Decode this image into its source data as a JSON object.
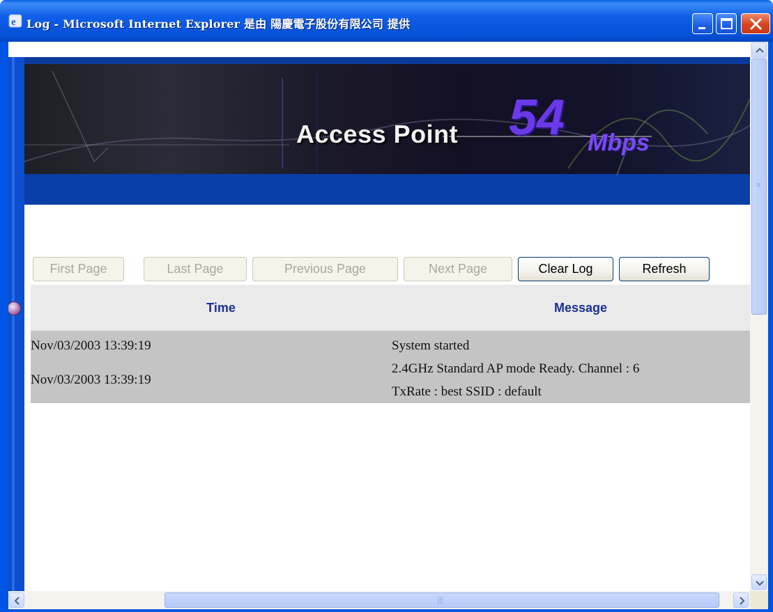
{
  "window": {
    "title": "Log - Microsoft Internet Explorer 是由 陽慶電子股份有限公司 提供"
  },
  "banner": {
    "product_text": "Access Point",
    "speed": "54",
    "speed_unit": "Mbps"
  },
  "buttons": {
    "first_page": "First Page",
    "last_page": "Last Page",
    "previous_page": "Previous Page",
    "next_page": "Next Page",
    "clear_log": "Clear Log",
    "refresh": "Refresh"
  },
  "log": {
    "columns": [
      "Time",
      "Message"
    ],
    "rows": [
      {
        "time": "Nov/03/2003 13:39:19",
        "message": [
          "System started"
        ]
      },
      {
        "time": "Nov/03/2003 13:39:19",
        "message": [
          "2.4GHz Standard AP mode Ready. Channel : 6",
          "TxRate : best SSID : default"
        ]
      }
    ]
  },
  "colors": {
    "title_bar": "#0054e3",
    "banner_blue": "#0a3fa8",
    "header_text": "#1d2f93",
    "row_bg": "#c4c4c4"
  }
}
